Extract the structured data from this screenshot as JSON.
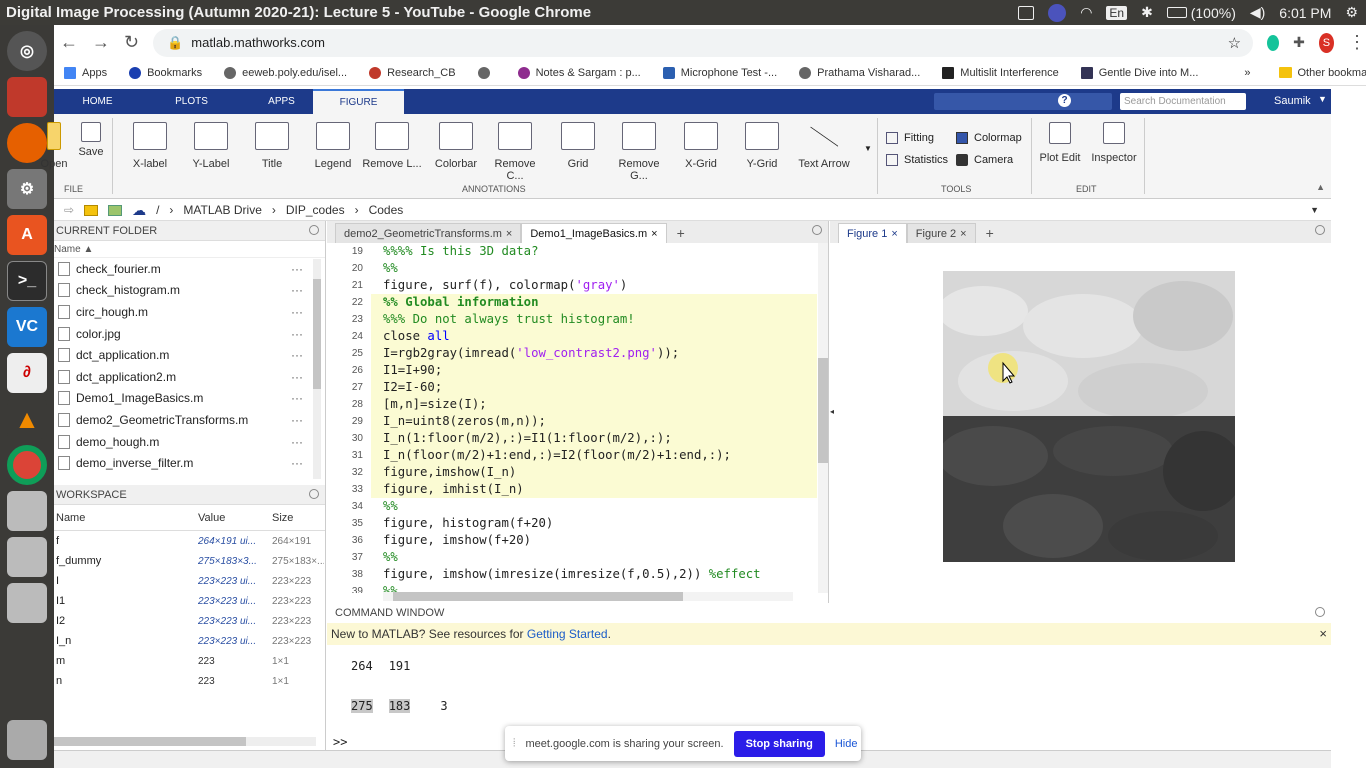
{
  "system": {
    "window_title": "Digital Image Processing (Autumn 2020-21): Lecture 5 - YouTube - Google Chrome",
    "lang": "En",
    "battery": "(100%)",
    "time": "6:01 PM"
  },
  "browser": {
    "url": "matlab.mathworks.com",
    "profile_initial": "S",
    "bookmarks": [
      "Apps",
      "Bookmarks",
      "eeweb.poly.edu/isel...",
      "Research_CB",
      "Notes & Sargam : p...",
      "Microphone Test -...",
      "Prathama Visharad...",
      "Multislit Interference",
      "Gentle Dive into M..."
    ],
    "other_bookmarks": "Other bookmarks",
    "more": "»"
  },
  "matlab": {
    "tabs": [
      "HOME",
      "PLOTS",
      "APPS",
      "FIGURE"
    ],
    "search_placeholder": "Search Documentation",
    "user": "Saumik",
    "ribbon": {
      "file": [
        "Open",
        "Save"
      ],
      "annotations": [
        "X-label",
        "Y-Label",
        "Title",
        "Legend",
        "Remove L...",
        "Colorbar",
        "Remove C...",
        "Grid",
        "Remove G...",
        "X-Grid",
        "Y-Grid",
        "Text Arrow"
      ],
      "tools": [
        "Fitting",
        "Statistics",
        "Colormap",
        "Camera"
      ],
      "edit": [
        "Plot Edit",
        "Inspector"
      ],
      "sections": [
        "FILE",
        "ANNOTATIONS",
        "TOOLS",
        "EDIT"
      ]
    },
    "path": [
      "/",
      "MATLAB Drive",
      "DIP_codes",
      "Codes"
    ],
    "current_folder": {
      "title": "CURRENT FOLDER",
      "col": "Name",
      "files": [
        "check_fourier.m",
        "check_histogram.m",
        "circ_hough.m",
        "color.jpg",
        "dct_application.m",
        "dct_application2.m",
        "Demo1_ImageBasics.m",
        "demo2_GeometricTransforms.m",
        "demo_hough.m",
        "demo_inverse_filter.m"
      ]
    },
    "workspace": {
      "title": "WORKSPACE",
      "cols": [
        "Name",
        "Value",
        "Size"
      ],
      "rows": [
        {
          "n": "f",
          "v": "264×191 ui...",
          "s": "264×191"
        },
        {
          "n": "f_dummy",
          "v": "275×183×3...",
          "s": "275×183×..."
        },
        {
          "n": "I",
          "v": "223×223 ui...",
          "s": "223×223"
        },
        {
          "n": "I1",
          "v": "223×223 ui...",
          "s": "223×223"
        },
        {
          "n": "I2",
          "v": "223×223 ui...",
          "s": "223×223"
        },
        {
          "n": "I_n",
          "v": "223×223 ui...",
          "s": "223×223"
        },
        {
          "n": "m",
          "v": "223",
          "s": "1×1"
        },
        {
          "n": "n",
          "v": "223",
          "s": "1×1"
        }
      ]
    },
    "editor": {
      "tabs": [
        "demo2_GeometricTransforms.m",
        "Demo1_ImageBasics.m"
      ],
      "lines": [
        {
          "n": "19",
          "t": "%%%% Is this 3D data?",
          "k": "c",
          "hl": false
        },
        {
          "n": "20",
          "t": "%%",
          "k": "c",
          "hl": false
        },
        {
          "n": "21",
          "t": "figure, surf(f), colormap('gray')",
          "k": "n",
          "hl": false
        },
        {
          "n": "22",
          "t": "%% Global information",
          "k": "cb",
          "hl": true
        },
        {
          "n": "23",
          "t": "%%% Do not always trust histogram!",
          "k": "c",
          "hl": true
        },
        {
          "n": "24",
          "t": "close all",
          "k": "n",
          "hl": true
        },
        {
          "n": "25",
          "t": "I=rgb2gray(imread('low_contrast2.png'));",
          "k": "n",
          "hl": true
        },
        {
          "n": "26",
          "t": "I1=I+90;",
          "k": "n",
          "hl": true
        },
        {
          "n": "27",
          "t": "I2=I-60;",
          "k": "n",
          "hl": true
        },
        {
          "n": "28",
          "t": "[m,n]=size(I);",
          "k": "n",
          "hl": true
        },
        {
          "n": "29",
          "t": "I_n=uint8(zeros(m,n));",
          "k": "n",
          "hl": true
        },
        {
          "n": "30",
          "t": "I_n(1:floor(m/2),:)=I1(1:floor(m/2),:);",
          "k": "n",
          "hl": true
        },
        {
          "n": "31",
          "t": "I_n(floor(m/2)+1:end,:)=I2(floor(m/2)+1:end,:);",
          "k": "n",
          "hl": true
        },
        {
          "n": "32",
          "t": "figure,imshow(I_n)",
          "k": "n",
          "hl": true
        },
        {
          "n": "33",
          "t": "figure, imhist(I_n)",
          "k": "n",
          "hl": true
        },
        {
          "n": "34",
          "t": "%%",
          "k": "c",
          "hl": false
        },
        {
          "n": "35",
          "t": "figure, histogram(f+20)",
          "k": "n",
          "hl": false
        },
        {
          "n": "36",
          "t": "figure, imshow(f+20)",
          "k": "n",
          "hl": false
        },
        {
          "n": "37",
          "t": "%%",
          "k": "c",
          "hl": false
        },
        {
          "n": "38",
          "t": "figure, imshow(imresize(imresize(f,0.5),2)) %effect",
          "k": "n",
          "hl": false
        },
        {
          "n": "39",
          "t": "%%",
          "k": "c",
          "hl": false
        }
      ]
    },
    "figures": {
      "tabs": [
        "Figure 1",
        "Figure 2"
      ]
    },
    "command_window": {
      "title": "COMMAND WINDOW",
      "banner": "New to MATLAB? See resources for ",
      "banner_link": "Getting Started",
      "banner_end": ".",
      "out1": [
        "264",
        "191"
      ],
      "out2": [
        "275",
        "183",
        "3"
      ],
      "prompt": ">>"
    }
  },
  "meet": {
    "text": "meet.google.com is sharing your screen.",
    "stop": "Stop sharing",
    "hide": "Hide"
  }
}
